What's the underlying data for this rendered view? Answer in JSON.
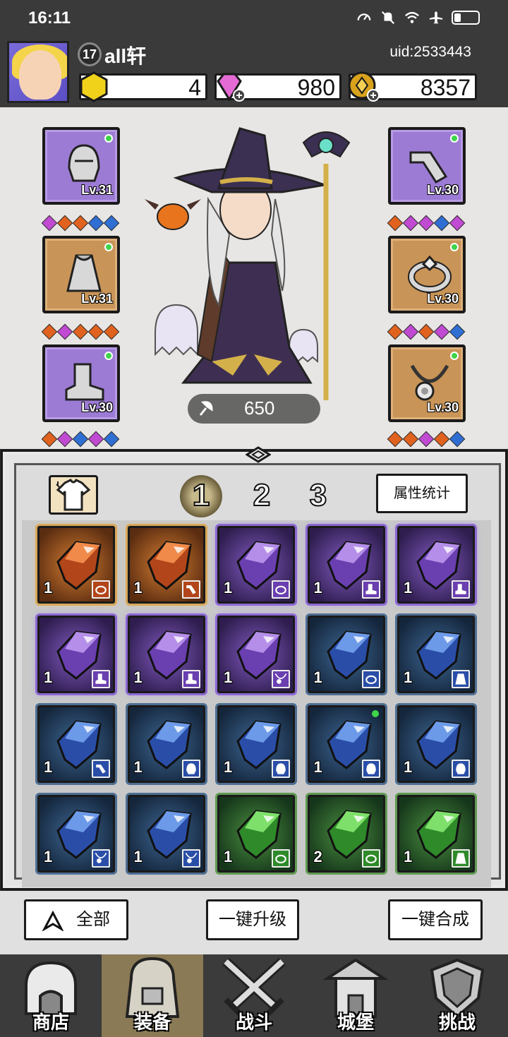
{
  "status_bar": {
    "time": "16:11",
    "icons": [
      "speed-icon",
      "mute-icon",
      "wifi-icon",
      "airplane-icon",
      "battery-icon"
    ]
  },
  "player": {
    "level": "17",
    "name": "all轩",
    "uid": "uid:2533443"
  },
  "resources": {
    "gold_gem": "4",
    "diamonds": "980",
    "coins": "8357"
  },
  "equipment": {
    "left": [
      {
        "item": "helmet",
        "level": "Lv.31",
        "rarity": "purple",
        "gems": [
          "purple",
          "orange",
          "orange",
          "blue",
          "blue"
        ]
      },
      {
        "item": "cape",
        "level": "Lv.31",
        "rarity": "orange",
        "gems": [
          "orange",
          "purple",
          "orange",
          "orange",
          "orange"
        ]
      },
      {
        "item": "boot",
        "level": "Lv.30",
        "rarity": "purple",
        "gems": [
          "orange",
          "purple",
          "blue",
          "purple",
          "blue"
        ]
      }
    ],
    "right": [
      {
        "item": "bracer",
        "level": "Lv.30",
        "rarity": "purple",
        "gems": [
          "orange",
          "purple",
          "purple",
          "blue",
          "purple"
        ]
      },
      {
        "item": "ring",
        "level": "Lv.30",
        "rarity": "orange",
        "gems": [
          "orange",
          "purple",
          "orange",
          "purple",
          "blue"
        ]
      },
      {
        "item": "necklace",
        "level": "Lv.30",
        "rarity": "orange",
        "gems": [
          "orange",
          "orange",
          "purple",
          "orange",
          "blue"
        ]
      }
    ]
  },
  "hero": {
    "power": "650"
  },
  "inventory": {
    "tabs": [
      "1",
      "2",
      "3"
    ],
    "active_tab": "1",
    "attr_button": "属性统计",
    "items": [
      {
        "rarity": "orange",
        "count": "1",
        "slot": "ring"
      },
      {
        "rarity": "orange",
        "count": "1",
        "slot": "bracer"
      },
      {
        "rarity": "purple",
        "count": "1",
        "slot": "ring"
      },
      {
        "rarity": "purple",
        "count": "1",
        "slot": "boot"
      },
      {
        "rarity": "purple",
        "count": "1",
        "slot": "boot"
      },
      {
        "rarity": "purple",
        "count": "1",
        "slot": "boot"
      },
      {
        "rarity": "purple",
        "count": "1",
        "slot": "boot"
      },
      {
        "rarity": "purple",
        "count": "1",
        "slot": "necklace"
      },
      {
        "rarity": "blue",
        "count": "1",
        "slot": "ring"
      },
      {
        "rarity": "blue",
        "count": "1",
        "slot": "armor"
      },
      {
        "rarity": "blue",
        "count": "1",
        "slot": "bracer"
      },
      {
        "rarity": "blue",
        "count": "1",
        "slot": "helmet"
      },
      {
        "rarity": "blue",
        "count": "1",
        "slot": "helmet"
      },
      {
        "rarity": "blue",
        "count": "1",
        "slot": "helmet"
      },
      {
        "rarity": "blue",
        "count": "1",
        "slot": "helmet"
      },
      {
        "rarity": "blue",
        "count": "1",
        "slot": "necklace"
      },
      {
        "rarity": "blue",
        "count": "1",
        "slot": "necklace"
      },
      {
        "rarity": "green",
        "count": "1",
        "slot": "ring"
      },
      {
        "rarity": "green",
        "count": "2",
        "slot": "ring"
      },
      {
        "rarity": "green",
        "count": "1",
        "slot": "armor"
      }
    ]
  },
  "actions": {
    "all": "全部",
    "upgrade": "一键升级",
    "merge": "一键合成"
  },
  "nav": {
    "shop": "商店",
    "equip": "装备",
    "battle": "战斗",
    "castle": "城堡",
    "challenge": "挑战",
    "active": "equip"
  },
  "colors": {
    "purple_rarity": "#9c7bd4",
    "orange_rarity": "#c99457",
    "blue_rarity": "#34577e",
    "green_rarity": "#3f7a38"
  }
}
